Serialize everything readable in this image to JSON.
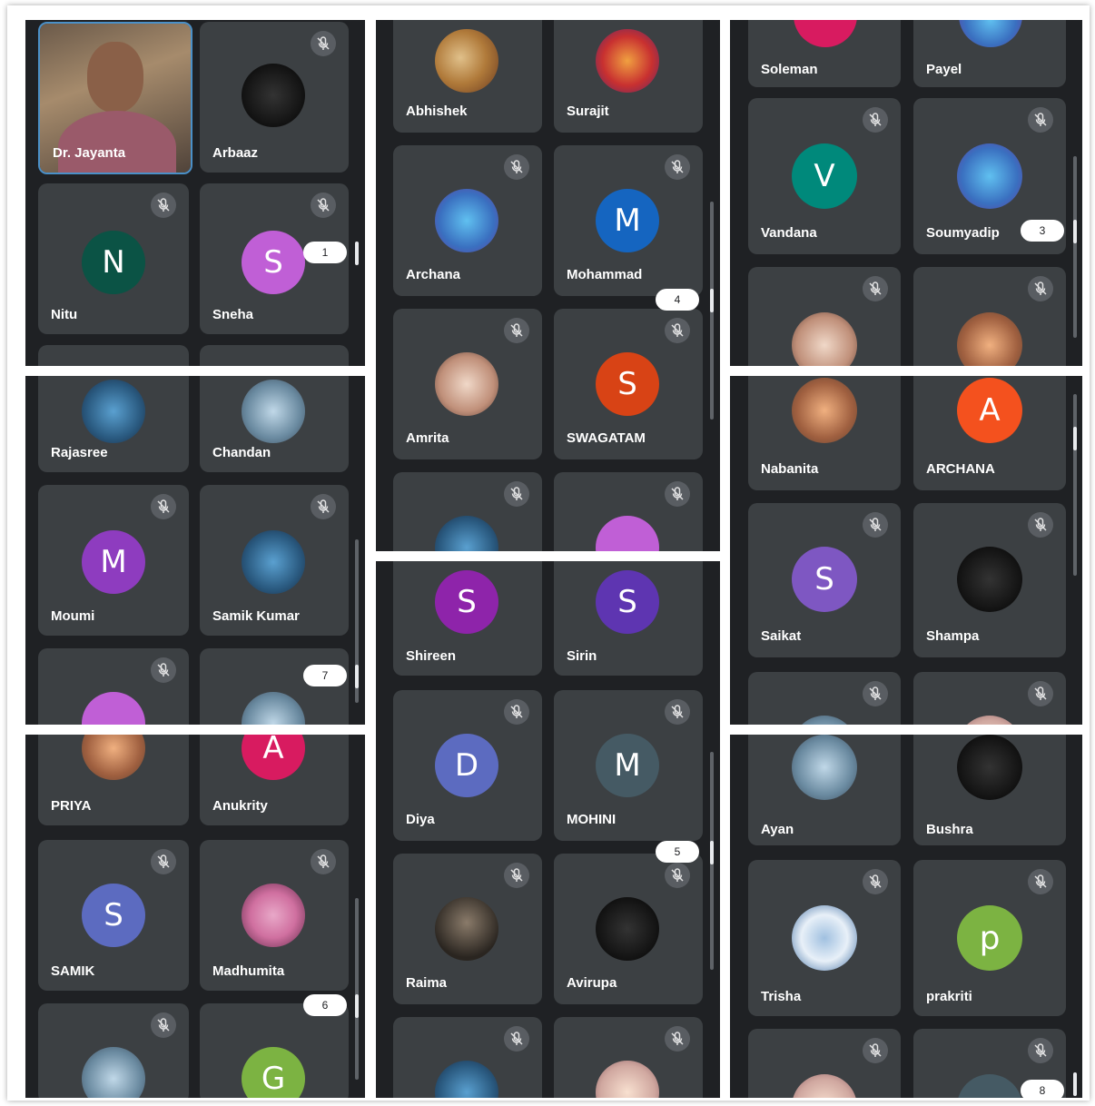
{
  "participants": {
    "jayanta": "Dr. Jayanta",
    "arbaaz": "Arbaaz",
    "nitu": "Nitu",
    "sneha": "Sneha",
    "rajasree": "Rajasree",
    "chandan": "Chandan",
    "moumi": "Moumi",
    "samik_kumar": "Samik Kumar",
    "priya": "PRIYA",
    "anukrity": "Anukrity",
    "samik": "SAMIK",
    "madhumita": "Madhumita",
    "abhishek": "Abhishek",
    "surajit": "Surajit",
    "archana": "Archana",
    "mohammad": "Mohammad",
    "amrita": "Amrita",
    "swagatam": "SWAGATAM",
    "shireen": "Shireen",
    "sirin": "Sirin",
    "diya": "Diya",
    "mohini": "MOHINI",
    "raima": "Raima",
    "avirupa": "Avirupa",
    "soleman": "Soleman",
    "payel": "Payel",
    "vandana": "Vandana",
    "soumyadip": "Soumyadip",
    "nabanita": "Nabanita",
    "archana_caps": "ARCHANA",
    "saikat": "Saikat",
    "shampa": "Shampa",
    "ayan": "Ayan",
    "bushra": "Bushra",
    "trisha": "Trisha",
    "prakriti": "prakriti"
  },
  "initials": {
    "nitu": "N",
    "sneha": "S",
    "moumi": "M",
    "anukrity": "A",
    "samik": "S",
    "g": "G",
    "mohammad": "M",
    "swagatam": "S",
    "shireen": "S",
    "sirin": "S",
    "diya": "D",
    "mohini": "M",
    "vandana": "V",
    "archana_caps": "A",
    "saikat": "S",
    "prakriti": "p"
  },
  "page_markers": [
    "1",
    "7",
    "6",
    "4",
    "5",
    "3",
    "8"
  ],
  "colors": {
    "panel_bg": "#1f2124",
    "tile_bg": "#3c4043",
    "nitu": "#0b5345",
    "sneha": "#c05fd6",
    "moumi": "#8e3cbf",
    "anukrity": "#d81b60",
    "samik": "#5c6bc0",
    "g": "#7cb342",
    "mohammad": "#1565c0",
    "swagatam": "#d84315",
    "shireen": "#8e24aa",
    "sirin": "#5e35b1",
    "diya": "#5c6bc0",
    "mohini": "#455a64",
    "vandana": "#00897b",
    "archana_caps": "#f4511e",
    "saikat": "#7e57c2",
    "prakriti": "#7cb342"
  },
  "icons": [
    "mic-off-icon"
  ]
}
